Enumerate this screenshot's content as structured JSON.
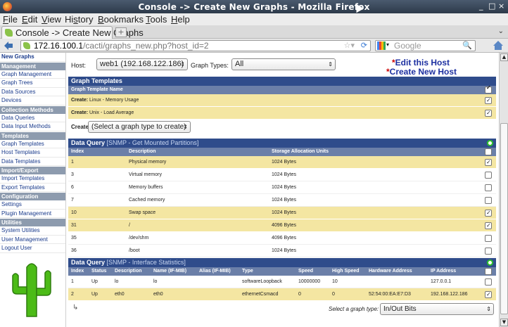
{
  "window": {
    "title": "Console -> Create New Graphs - Mozilla Firefox",
    "controls": [
      "_",
      "□",
      "×"
    ]
  },
  "menu": [
    "File",
    "Edit",
    "View",
    "History",
    "Bookmarks",
    "Tools",
    "Help"
  ],
  "menu_underline": [
    "F",
    "E",
    "V",
    "s",
    "B",
    "T",
    "H"
  ],
  "tab": {
    "label": "Console -> Create New Graphs"
  },
  "url": {
    "host": "172.16.100.1",
    "path": "/cacti/graphs_new.php?host_id=2"
  },
  "search": {
    "placeholder": "Google"
  },
  "sidebar": {
    "items": [
      {
        "type": "item",
        "label": "New Graphs",
        "bold": true
      },
      {
        "type": "header",
        "label": "Management"
      },
      {
        "type": "item",
        "label": "Graph Management"
      },
      {
        "type": "item",
        "label": "Graph Trees"
      },
      {
        "type": "item",
        "label": "Data Sources"
      },
      {
        "type": "item",
        "label": "Devices"
      },
      {
        "type": "header",
        "label": "Collection Methods"
      },
      {
        "type": "item",
        "label": "Data Queries"
      },
      {
        "type": "item",
        "label": "Data Input Methods"
      },
      {
        "type": "header",
        "label": "Templates"
      },
      {
        "type": "item",
        "label": "Graph Templates"
      },
      {
        "type": "item",
        "label": "Host Templates"
      },
      {
        "type": "item",
        "label": "Data Templates"
      },
      {
        "type": "header",
        "label": "Import/Export"
      },
      {
        "type": "item",
        "label": "Import Templates"
      },
      {
        "type": "item",
        "label": "Export Templates"
      },
      {
        "type": "header",
        "label": "Configuration"
      },
      {
        "type": "item",
        "label": "Settings"
      },
      {
        "type": "item",
        "label": "Plugin Management"
      },
      {
        "type": "header",
        "label": "Utilities"
      },
      {
        "type": "item",
        "label": "System Utilities"
      },
      {
        "type": "item",
        "label": "User Management"
      },
      {
        "type": "item",
        "label": "Logout User"
      }
    ]
  },
  "host": {
    "label": "Host:",
    "value": "web1 (192.168.122.186)",
    "graph_types_label": "Graph Types:",
    "graph_types_value": "All"
  },
  "host_links": {
    "edit": "Edit this Host",
    "create": "Create New Host",
    "asterisk": "*"
  },
  "graph_templates": {
    "title": "Graph Templates",
    "col": "Graph Template Name",
    "rows": [
      {
        "prefix": "Create:",
        "name": "Linux - Memory Usage",
        "checked": true
      },
      {
        "prefix": "Create:",
        "name": "Unix - Load Average",
        "checked": true
      }
    ],
    "create_label": "Create:",
    "create_select": "(Select a graph type to create)"
  },
  "dq_storage": {
    "title": "Data Query",
    "subtitle": "[SNMP - Get Mounted Partitions]",
    "cols": [
      "Index",
      "Description",
      "Storage Allocation Units"
    ],
    "rows": [
      {
        "index": "1",
        "desc": "Physical memory",
        "units": "1024 Bytes",
        "checked": true
      },
      {
        "index": "3",
        "desc": "Virtual memory",
        "units": "1024 Bytes",
        "checked": false
      },
      {
        "index": "6",
        "desc": "Memory buffers",
        "units": "1024 Bytes",
        "checked": false
      },
      {
        "index": "7",
        "desc": "Cached memory",
        "units": "1024 Bytes",
        "checked": false
      },
      {
        "index": "10",
        "desc": "Swap space",
        "units": "1024 Bytes",
        "checked": true
      },
      {
        "index": "31",
        "desc": "/",
        "units": "4096 Bytes",
        "checked": true
      },
      {
        "index": "35",
        "desc": "/dev/shm",
        "units": "4096 Bytes",
        "checked": false
      },
      {
        "index": "36",
        "desc": "/boot",
        "units": "1024 Bytes",
        "checked": false
      }
    ]
  },
  "dq_iface": {
    "title": "Data Query",
    "subtitle": "[SNMP - Interface Statistics]",
    "cols": [
      "Index",
      "Status",
      "Description",
      "Name (IF-MIB)",
      "Alias (IF-MIB)",
      "Type",
      "Speed",
      "High Speed",
      "Hardware Address",
      "IP Address"
    ],
    "rows": [
      {
        "cells": [
          "1",
          "Up",
          "lo",
          "lo",
          "",
          "softwareLoopback",
          "10000000",
          "10",
          "",
          "127.0.0.1"
        ],
        "checked": false
      },
      {
        "cells": [
          "2",
          "Up",
          "eth0",
          "eth0",
          "",
          "ethernetCsmacd",
          "0",
          "0",
          "52:54:00:EA:E7:D3",
          "192.168.122.186"
        ],
        "checked": true
      }
    ],
    "select_label": "Select a graph type:",
    "select_value": "In/Out Bits"
  },
  "colors": {
    "box_title": "#2f4c8b",
    "col_header": "#6b7fa8",
    "highlight": "#f4e6a2",
    "sidebar_header": "#8d9bae",
    "link": "#1c2fa0"
  }
}
